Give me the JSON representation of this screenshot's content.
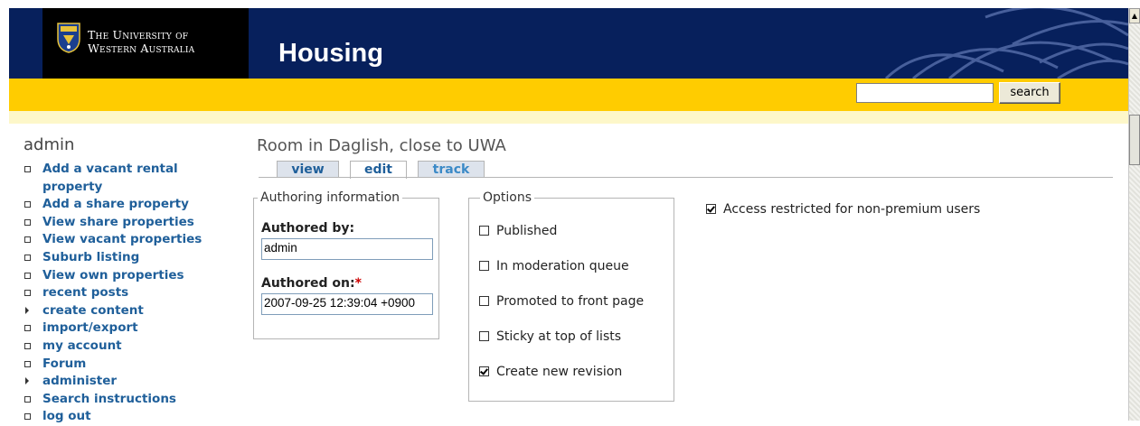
{
  "header": {
    "university_line1": "The University of",
    "university_line2": "Western Australia",
    "site_title": "Housing",
    "search_placeholder": "",
    "search_button": "search"
  },
  "sidebar": {
    "title": "admin",
    "items": [
      {
        "label": "Add a vacant rental property",
        "type": "leaf"
      },
      {
        "label": "Add a share property",
        "type": "leaf"
      },
      {
        "label": "View share properties",
        "type": "leaf"
      },
      {
        "label": "View vacant properties",
        "type": "leaf"
      },
      {
        "label": "Suburb listing",
        "type": "leaf"
      },
      {
        "label": "View own properties",
        "type": "leaf"
      },
      {
        "label": "recent posts",
        "type": "leaf"
      },
      {
        "label": "create content",
        "type": "collapsed"
      },
      {
        "label": "import/export",
        "type": "leaf"
      },
      {
        "label": "my account",
        "type": "leaf"
      },
      {
        "label": "Forum",
        "type": "leaf"
      },
      {
        "label": "administer",
        "type": "collapsed"
      },
      {
        "label": "Search instructions",
        "type": "leaf"
      },
      {
        "label": "log out",
        "type": "leaf"
      }
    ]
  },
  "main": {
    "node_title": "Room in Daglish, close to UWA",
    "tabs": [
      {
        "label": "view",
        "active": false
      },
      {
        "label": "edit",
        "active": true
      },
      {
        "label": "track",
        "active": false
      }
    ],
    "authoring": {
      "legend": "Authoring information",
      "authored_by_label": "Authored by:",
      "authored_by_value": "admin",
      "authored_on_label": "Authored on:",
      "required_mark": "*",
      "authored_on_value": "2007-09-25 12:39:04 +0900"
    },
    "options": {
      "legend": "Options",
      "items": [
        {
          "label": "Published",
          "checked": false
        },
        {
          "label": "In moderation queue",
          "checked": false
        },
        {
          "label": "Promoted to front page",
          "checked": false
        },
        {
          "label": "Sticky at top of lists",
          "checked": false
        },
        {
          "label": "Create new revision",
          "checked": true
        }
      ]
    },
    "access": {
      "label": "Access restricted for non-premium users",
      "checked": true
    }
  },
  "colors": {
    "banner": "#07205c",
    "accent_yellow": "#ffcc00",
    "cream": "#fdf7c9",
    "link": "#1f5f9a"
  }
}
